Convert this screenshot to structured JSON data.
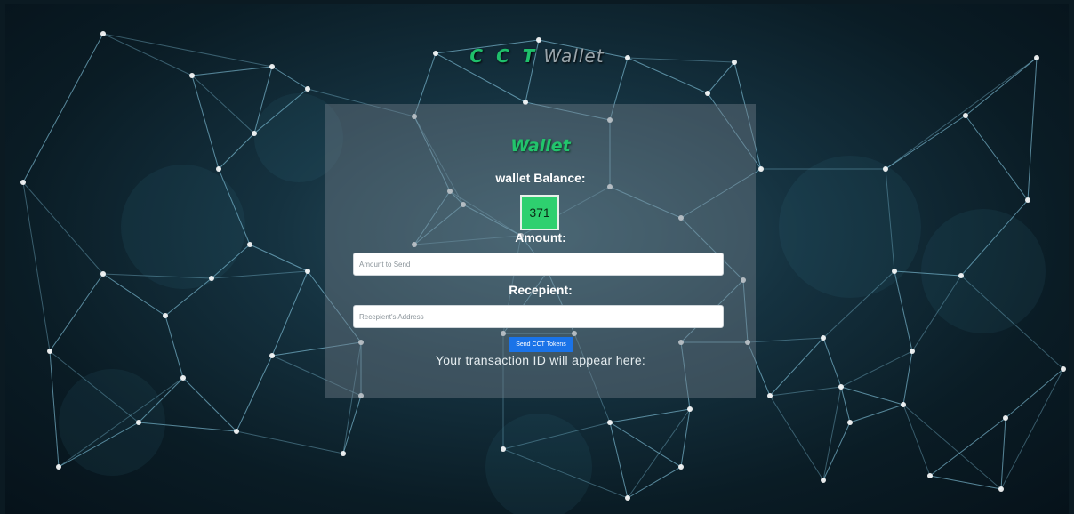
{
  "header": {
    "brand_cct": "C C T",
    "brand_wallet": "Wallet"
  },
  "wallet": {
    "title": "Wallet",
    "balance_label": "wallet Balance:",
    "balance_value": "371",
    "amount_label": "Amount:",
    "amount_placeholder": "Amount to Send",
    "amount_value": "",
    "recipient_label": "Recepient:",
    "recipient_placeholder": "Recepient's Address",
    "recipient_value": "",
    "send_button_label": "Send CCT Tokens",
    "transaction_text": "Your transaction ID will appear here:"
  },
  "colors": {
    "accent_green": "#1fbf6b",
    "balance_box": "#2ed06f",
    "button_blue": "#1a73e8",
    "background": "#0b1a22"
  }
}
